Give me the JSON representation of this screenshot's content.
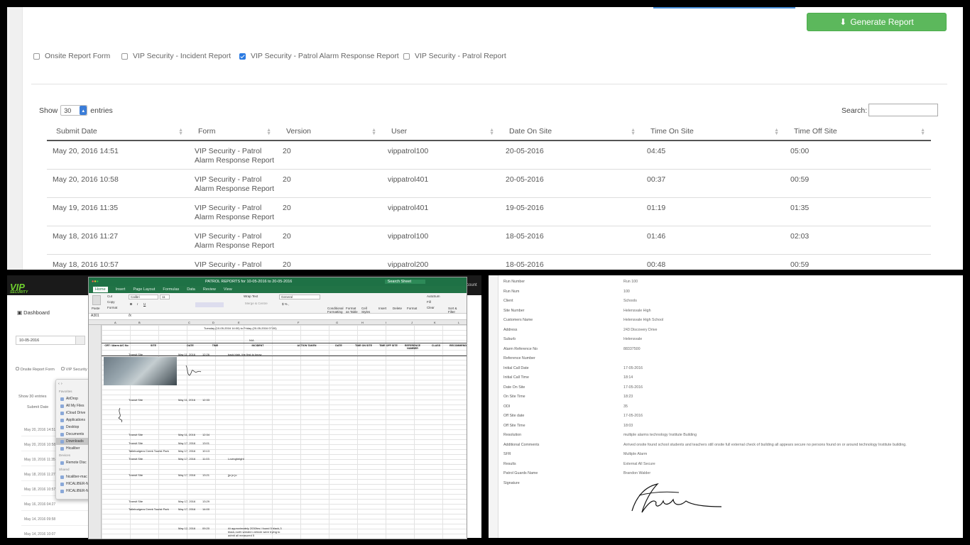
{
  "top": {
    "generate_label": "Generate Report",
    "forms": [
      {
        "label": "Onsite Report Form",
        "checked": false
      },
      {
        "label": "VIP Security - Incident Report",
        "checked": false
      },
      {
        "label": "VIP Security - Patrol Alarm Response Report",
        "checked": true
      },
      {
        "label": "VIP Security - Patrol Report",
        "checked": false
      }
    ],
    "show_label": "Show",
    "show_value": "30",
    "entries_label": "entries",
    "search_label": "Search:",
    "columns": [
      "Submit Date",
      "Form",
      "Version",
      "User",
      "Date On Site",
      "Time On Site",
      "Time Off Site"
    ],
    "rows": [
      [
        "May 20, 2016 14:51",
        "VIP Security - Patrol",
        "Alarm Response Report",
        "20",
        "vippatrol100",
        "20-05-2016",
        "04:45",
        "05:00"
      ],
      [
        "May 20, 2016 10:58",
        "VIP Security - Patrol",
        "Alarm Response Report",
        "20",
        "vippatrol401",
        "20-05-2016",
        "00:37",
        "00:59"
      ],
      [
        "May 19, 2016 11:35",
        "VIP Security - Patrol",
        "Alarm Response Report",
        "20",
        "vippatrol401",
        "19-05-2016",
        "01:19",
        "01:35"
      ],
      [
        "May 18, 2016 11:27",
        "VIP Security - Patrol",
        "Alarm Response Report",
        "20",
        "vippatrol100",
        "18-05-2016",
        "01:46",
        "02:03"
      ],
      [
        "May 18, 2016 10:57",
        "VIP Security - Patrol",
        "Alarm Response Report",
        "20",
        "vippatrol200",
        "18-05-2016",
        "00:48",
        "00:59"
      ]
    ]
  },
  "bottom_left": {
    "logo": "VIP",
    "logo_sub": "SECURITY",
    "account": "Account",
    "dashboard": "Dashboard",
    "date_value": "10-05-2016",
    "cb1": "Onsite Report Form",
    "cb2": "VIP Security -",
    "show": "Show",
    "show_val": "30",
    "entries": "entries",
    "submit_date": "Submit Date",
    "list": [
      "May 20, 2016 14:51",
      "May 20, 2016 10:58",
      "May 19, 2016 11:35",
      "May 18, 2016 11:27",
      "May 18, 2016 10:57",
      "May 16, 2016 04:27",
      "May 14, 2016 09:58",
      "May 14, 2016 10:07",
      "May 14, 2016 07:32"
    ],
    "finder": {
      "favorites": "Favorites",
      "items": [
        "AirDrop",
        "All My Files",
        "iCloud Drive",
        "Applications",
        "Desktop",
        "Documents",
        "Downloads",
        "Hicaliber"
      ],
      "devices": "Devices",
      "device_items": [
        "Remote Disc"
      ],
      "shared": "Shared",
      "shared_items": [
        "hicaliber-mac",
        "HICALIBER-N",
        "HICALIBER-N"
      ]
    },
    "excel": {
      "title": "PATROL REPORTS for 10-05-2016 to 20-05-2016",
      "search": "Search Sheet",
      "tabs": [
        "Home",
        "Insert",
        "Page Layout",
        "Formulas",
        "Data",
        "Review",
        "View"
      ],
      "font": "Calibri",
      "font_size": "11",
      "wrap": "Wrap Text",
      "merge": "Merge & Centre",
      "number_format": "General",
      "cell_ref": "A301",
      "fx": "fx",
      "paste": "Paste",
      "cut": "Cut",
      "copy": "Copy",
      "format": "Format",
      "cond": "Conditional Formatting",
      "fmt_table": "Format as Table",
      "cell_styles": "Cell Styles",
      "insert": "Insert",
      "delete": "Delete",
      "format2": "Format",
      "autosum": "AutoSum",
      "fill": "Fill",
      "clear": "Clear",
      "sort": "Sort & Filter",
      "col_letters": [
        "A",
        "B",
        "C",
        "D",
        "E",
        "F",
        "G",
        "H",
        "I",
        "J",
        "K",
        "L"
      ],
      "banner": "Tuesday (10-05-2016 14:00) to Friday (20-05-2016 07:00)",
      "na": "N/A",
      "headers": [
        "CRT / Alarm A/C No",
        "SITE",
        "DATE",
        "TIME",
        "INCIDENT",
        "ACTION TAKEN",
        "DATE",
        "TIME ON SITE",
        "TIME OFF SITE",
        "REFERENCE NUMBER",
        "CLASS",
        "RECOMMEND"
      ],
      "rows": [
        {
          "site": "Transit Site",
          "date": "May 11, 2016",
          "time": "12:26",
          "incident": "back blah, the first to know"
        },
        {
          "site": "Transit Site",
          "date": "May 11, 2016",
          "time": "12:33",
          "incident": ""
        },
        {
          "site": "Transit Site",
          "date": "May 11, 2016",
          "time": "12:34",
          "incident": ""
        },
        {
          "site": "Transit Site",
          "date": "May 17, 2016",
          "time": "13:01",
          "incident": ""
        },
        {
          "site": "Tallebudgera Creek Tourist Park",
          "date": "May 17, 2016",
          "time": "10:13",
          "incident": ""
        },
        {
          "site": "Transit Site",
          "date": "May 17, 2016",
          "time": "11:03",
          "incident": "Lovingheight"
        },
        {
          "site": "Transit Site",
          "date": "May 17, 2016",
          "time": "13:21",
          "incident": "jjo jo jo"
        },
        {
          "site": "Transit Site",
          "date": "May 17, 2016",
          "time": "13:29",
          "incident": ""
        },
        {
          "site": "Tallebudgera Creek Tourist Park",
          "date": "May 17, 2016",
          "time": "14:00",
          "incident": ""
        },
        {
          "site": "",
          "date": "May 12, 2016",
          "time": "09:20",
          "incident": "At approximately 2030hrs i found 5 black,3 black,north western vehicle were trying to admit all measured 5"
        }
      ]
    }
  },
  "bottom_right": {
    "fields": [
      [
        "Run Number",
        "Run 100"
      ],
      [
        "Run Num",
        "100"
      ],
      [
        "Client",
        "Schools"
      ],
      [
        "Site Number",
        "Helensvale High"
      ],
      [
        "Customers Name",
        "Helensvale High School"
      ],
      [
        "Address",
        "243 Discovery Drive"
      ],
      [
        "Suburb",
        "Helensvale"
      ],
      [
        "Alarm Reference No",
        "88337500"
      ],
      [
        "Reference Number",
        ""
      ],
      [
        "Initial Call Date",
        "17-05-2016"
      ],
      [
        "Initial Call Time",
        "18:14"
      ],
      [
        "Date On Site",
        "17-05-2016"
      ],
      [
        "On Site Time",
        "18:23"
      ],
      [
        "ODI",
        "35"
      ],
      [
        "Off Site date",
        "17-05-2016"
      ],
      [
        "Off Site Time",
        "18:03"
      ],
      [
        "Resolution",
        "multiple alarms technology Institute Building"
      ],
      [
        "Additional Comments",
        "Arrived onsite found school students and teachers still onsite full external check of building all appears secure no persons found on or around technology Institute building."
      ],
      [
        "SFR",
        "Multiple Alarm"
      ],
      [
        "Results",
        "External All Secure"
      ],
      [
        "Patrol Guards Name",
        "Brandon Walder"
      ],
      [
        "Signature",
        ""
      ]
    ]
  }
}
